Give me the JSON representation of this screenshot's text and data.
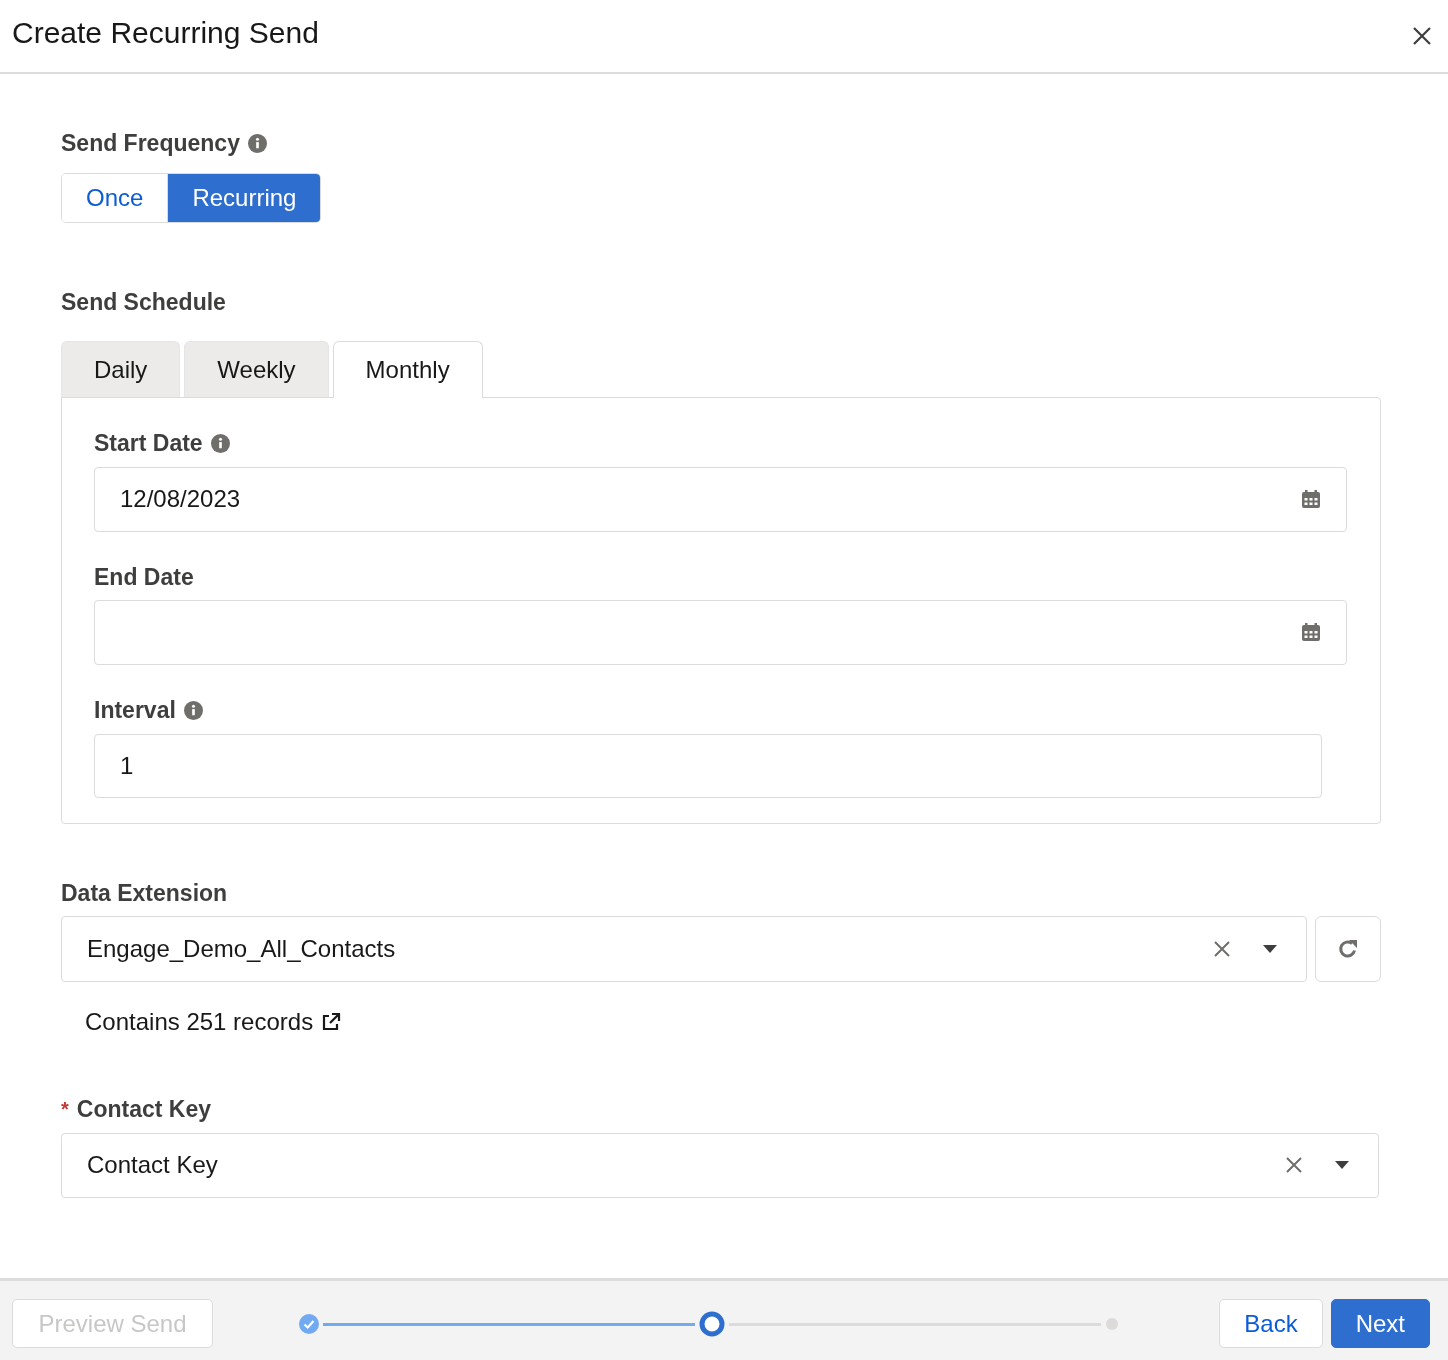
{
  "dialog": {
    "title": "Create Recurring Send"
  },
  "send_frequency": {
    "label": "Send Frequency",
    "options": [
      {
        "label": "Once",
        "selected": false
      },
      {
        "label": "Recurring",
        "selected": true
      }
    ]
  },
  "send_schedule": {
    "label": "Send Schedule",
    "tabs": [
      {
        "label": "Daily",
        "selected": false
      },
      {
        "label": "Weekly",
        "selected": false
      },
      {
        "label": "Monthly",
        "selected": true
      }
    ],
    "fields": [
      {
        "label": "Start Date",
        "info": true,
        "kind": "date",
        "value": "12/08/2023"
      },
      {
        "label": "End Date",
        "info": false,
        "kind": "date"
      },
      {
        "label": "Interval",
        "info": true,
        "kind": "text",
        "value": "1"
      }
    ]
  },
  "data_extension": {
    "label": "Data Extension",
    "value": "Engage_Demo_All_Contacts",
    "record_count": "Contains 251 records"
  },
  "contact_key": {
    "required_mark": "*",
    "label": "Contact Key",
    "value": "Contact Key"
  },
  "footer": {
    "preview_button": {
      "label": "Preview Send",
      "disabled": true
    },
    "steps": [
      {
        "kind": "complete"
      },
      {
        "kind": "current"
      },
      {
        "kind": "upcoming"
      }
    ],
    "buttons": [
      {
        "label": "Back",
        "kind": "neutral"
      },
      {
        "label": "Next",
        "kind": "brand"
      }
    ]
  }
}
